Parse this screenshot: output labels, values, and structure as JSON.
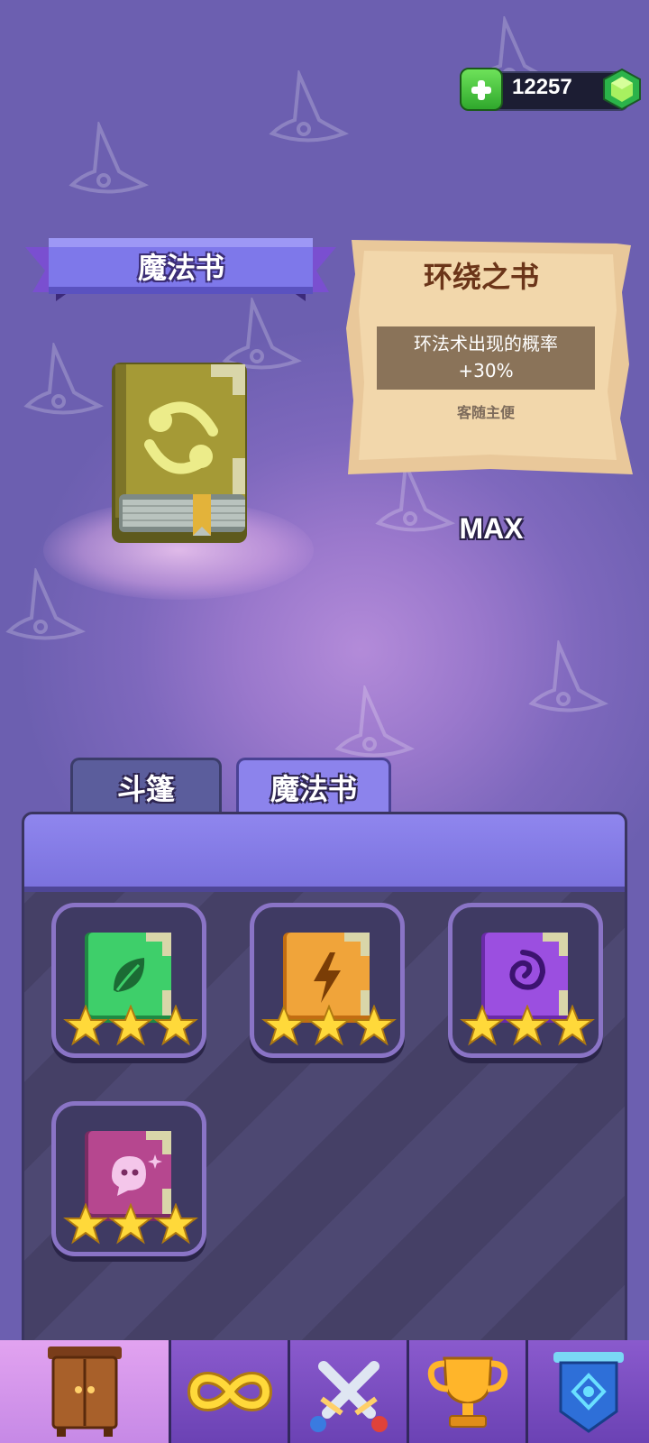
{
  "currency": {
    "amount": "12257",
    "add_icon": "plus-icon",
    "gem_icon": "green-gem-icon"
  },
  "banner": {
    "title": "魔法书"
  },
  "selected_item": {
    "icon": "green-loop-spellbook-icon"
  },
  "info_card": {
    "title": "环绕之书",
    "description_line1": "环法术出现的概率",
    "description_line2": "+30%",
    "subtitle": "客随主便"
  },
  "level_label": "MAX",
  "tabs": [
    {
      "label": "斗篷",
      "active": false
    },
    {
      "label": "魔法书",
      "active": true
    }
  ],
  "books": [
    {
      "icon": "leaf-spellbook-icon",
      "color": "#3ecf6a",
      "stars": 3
    },
    {
      "icon": "lightning-spellbook-icon",
      "color": "#f0a43a",
      "stars": 3
    },
    {
      "icon": "swirl-spellbook-icon",
      "color": "#9b4fe0",
      "stars": 3
    },
    {
      "icon": "ghost-spellbook-icon",
      "color": "#b6478f",
      "stars": 3
    }
  ],
  "nav": [
    {
      "icon": "wardrobe-icon",
      "selected": true
    },
    {
      "icon": "infinity-icon",
      "selected": false
    },
    {
      "icon": "crossed-swords-icon",
      "selected": false
    },
    {
      "icon": "trophy-icon",
      "selected": false
    },
    {
      "icon": "blue-banner-icon",
      "selected": false
    }
  ]
}
